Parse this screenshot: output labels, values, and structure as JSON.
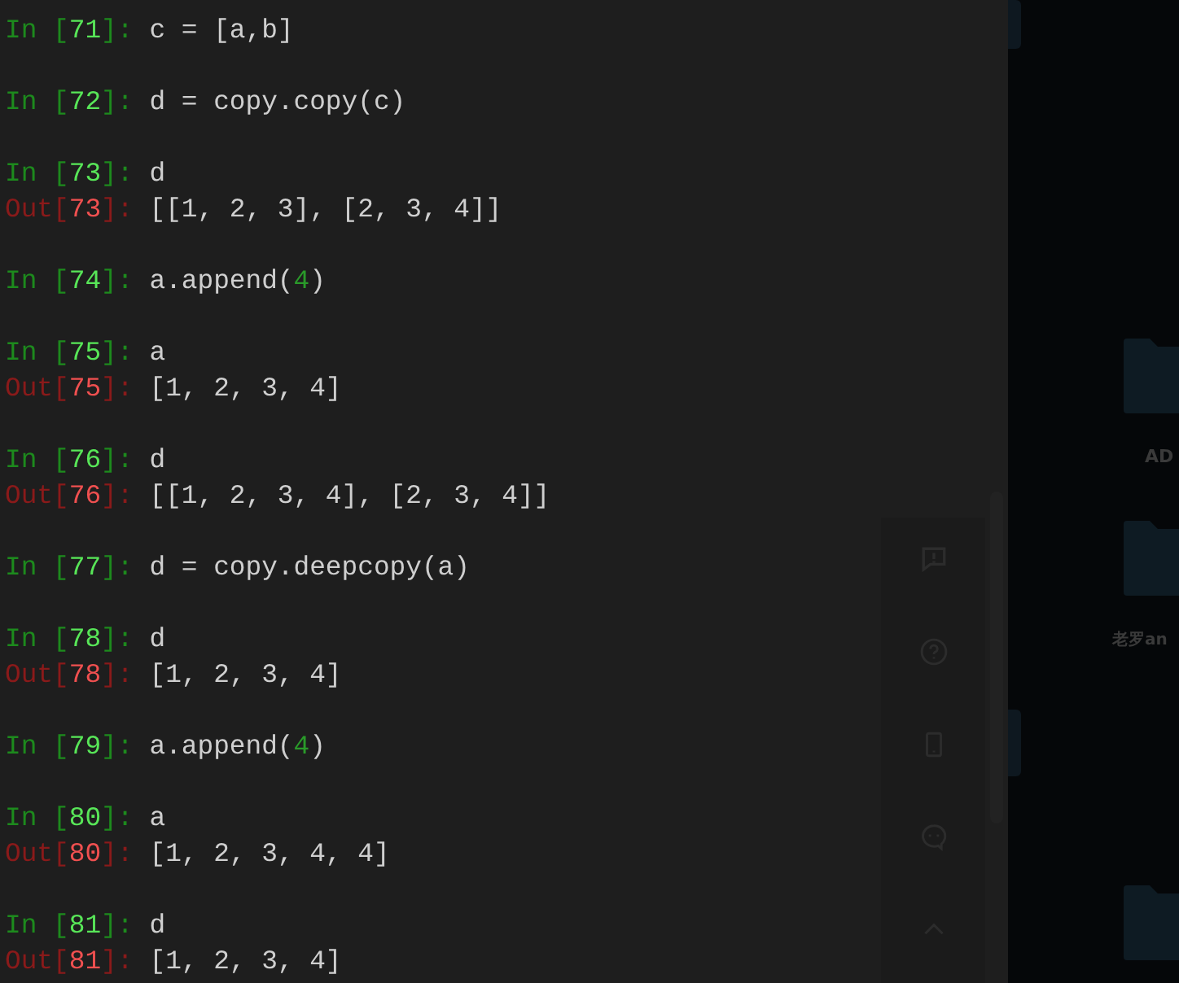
{
  "terminal": {
    "cells": [
      {
        "in_prompt": [
          "In [",
          "71",
          "]:"
        ],
        "input": [
          {
            "kind": "code",
            "text": "c = [a,b]"
          }
        ]
      },
      {
        "in_prompt": [
          "In [",
          "72",
          "]:"
        ],
        "input": [
          {
            "kind": "code",
            "text": "d = copy.copy(c)"
          }
        ]
      },
      {
        "in_prompt": [
          "In [",
          "73",
          "]:"
        ],
        "input": [
          {
            "kind": "code",
            "text": "d"
          }
        ],
        "out_prompt": [
          "Out[",
          "73",
          "]:"
        ],
        "output": "[[1, 2, 3], [2, 3, 4]]"
      },
      {
        "in_prompt": [
          "In [",
          "74",
          "]:"
        ],
        "input": [
          {
            "kind": "code",
            "text": "a.append("
          },
          {
            "kind": "number",
            "text": "4"
          },
          {
            "kind": "code",
            "text": ")"
          }
        ]
      },
      {
        "in_prompt": [
          "In [",
          "75",
          "]:"
        ],
        "input": [
          {
            "kind": "code",
            "text": "a"
          }
        ],
        "out_prompt": [
          "Out[",
          "75",
          "]:"
        ],
        "output": "[1, 2, 3, 4]"
      },
      {
        "in_prompt": [
          "In [",
          "76",
          "]:"
        ],
        "input": [
          {
            "kind": "code",
            "text": "d"
          }
        ],
        "out_prompt": [
          "Out[",
          "76",
          "]:"
        ],
        "output": "[[1, 2, 3, 4], [2, 3, 4]]"
      },
      {
        "in_prompt": [
          "In [",
          "77",
          "]:"
        ],
        "input": [
          {
            "kind": "code",
            "text": "d = copy.deepcopy(a)"
          }
        ]
      },
      {
        "in_prompt": [
          "In [",
          "78",
          "]:"
        ],
        "input": [
          {
            "kind": "code",
            "text": "d"
          }
        ],
        "out_prompt": [
          "Out[",
          "78",
          "]:"
        ],
        "output": "[1, 2, 3, 4]"
      },
      {
        "in_prompt": [
          "In [",
          "79",
          "]:"
        ],
        "input": [
          {
            "kind": "code",
            "text": "a.append("
          },
          {
            "kind": "number",
            "text": "4"
          },
          {
            "kind": "code",
            "text": ")"
          }
        ]
      },
      {
        "in_prompt": [
          "In [",
          "80",
          "]:"
        ],
        "input": [
          {
            "kind": "code",
            "text": "a"
          }
        ],
        "out_prompt": [
          "Out[",
          "80",
          "]:"
        ],
        "output": "[1, 2, 3, 4, 4]"
      },
      {
        "in_prompt": [
          "In [",
          "81",
          "]:"
        ],
        "input": [
          {
            "kind": "code",
            "text": "d"
          }
        ],
        "out_prompt": [
          "Out[",
          "81",
          "]:"
        ],
        "output": "[1, 2, 3, 4]"
      }
    ]
  },
  "side_toolbar": {
    "icons": [
      {
        "kind": "feedback"
      },
      {
        "kind": "help"
      },
      {
        "kind": "phone"
      },
      {
        "kind": "chat"
      },
      {
        "kind": "up"
      }
    ]
  },
  "desktop": {
    "icons": [
      {
        "kind": "folder",
        "label": "AD"
      },
      {
        "kind": "folder",
        "label": "老罗an"
      },
      {
        "kind": "folder"
      }
    ]
  }
}
